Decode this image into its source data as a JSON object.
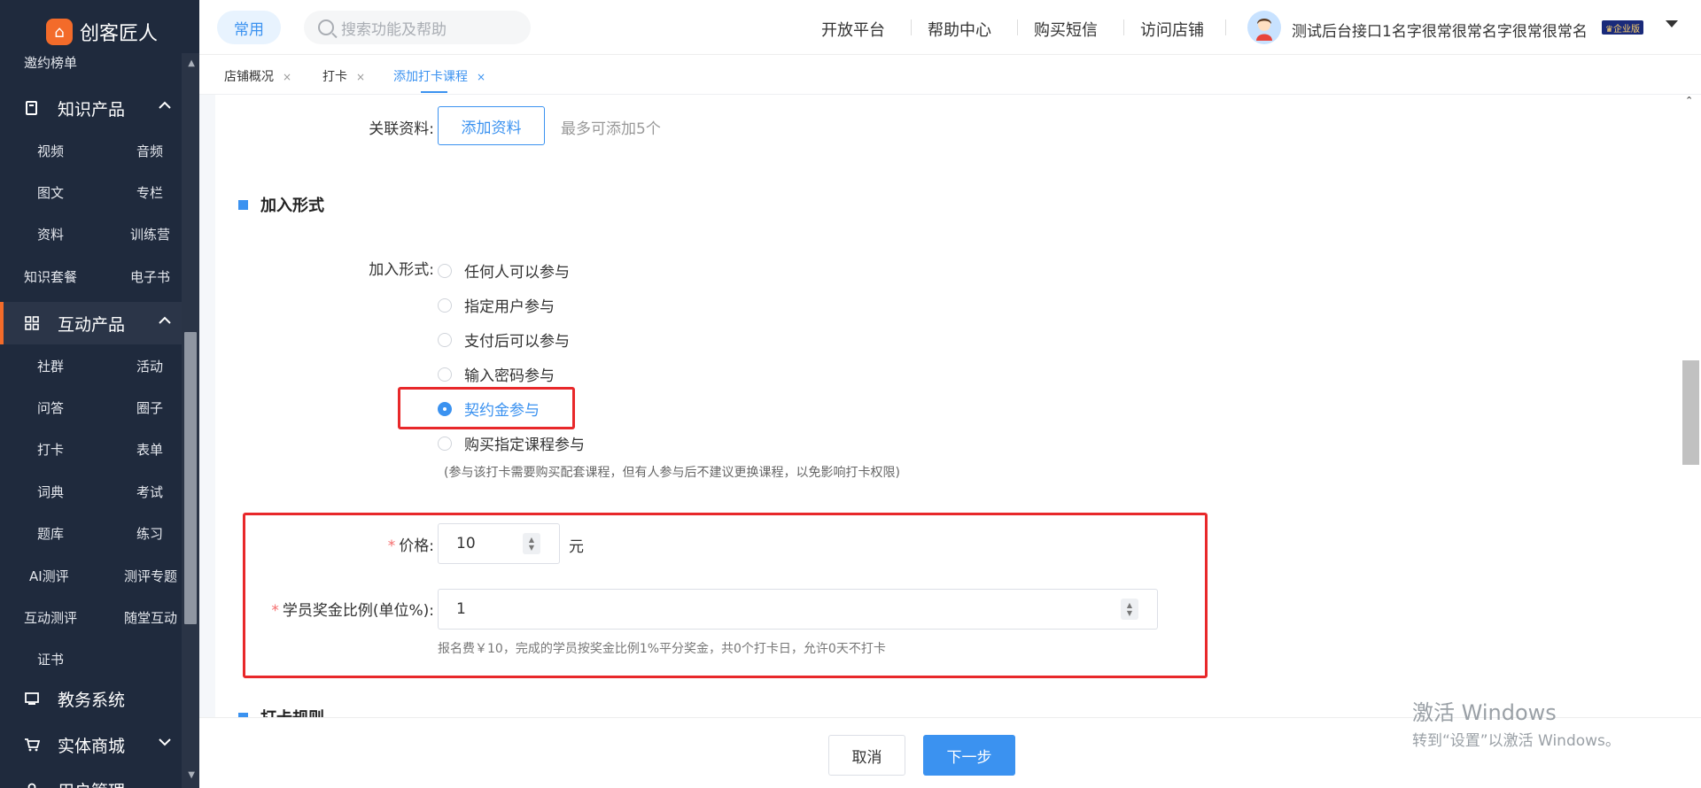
{
  "app": {
    "logo_mark": "⌂",
    "name": "创客匠人"
  },
  "sidebar": {
    "top_item": "邀约榜单",
    "groups": [
      {
        "label": "知识产品",
        "icon": "book-icon",
        "expanded": true
      },
      {
        "label": "互动产品",
        "icon": "grid-icon",
        "expanded": true,
        "active": true
      },
      {
        "label": "教务系统",
        "icon": "classroom-icon"
      },
      {
        "label": "实体商城",
        "icon": "cart-icon",
        "expanded": false
      },
      {
        "label": "用户管理",
        "icon": "user-icon"
      }
    ],
    "knowledge_items": [
      "视频",
      "音频",
      "图文",
      "专栏",
      "资料",
      "训练营",
      "知识套餐",
      "电子书"
    ],
    "interactive_items": [
      "社群",
      "活动",
      "问答",
      "圈子",
      "打卡",
      "表单",
      "词典",
      "考试",
      "题库",
      "练习",
      "AI测评",
      "测评专题",
      "互动测评",
      "随堂互动",
      "证书"
    ]
  },
  "topbar": {
    "pill": "常用",
    "search_placeholder": "搜索功能及帮助",
    "links": [
      "开放平台",
      "帮助中心",
      "购买短信",
      "访问店铺"
    ],
    "user_name": "测试后台接口1名字很常很常名字很常很常名",
    "badge": "♛企业版"
  },
  "tabs": [
    {
      "label": "店铺概况",
      "active": false
    },
    {
      "label": "打卡",
      "active": false
    },
    {
      "label": "添加打卡课程",
      "active": true
    }
  ],
  "form": {
    "related_label": "关联资料:",
    "add_material_button": "添加资料",
    "related_hint": "最多可添加5个",
    "join_section_title": "加入形式",
    "join_label": "加入形式:",
    "join_options": [
      {
        "label": "任何人可以参与",
        "selected": false
      },
      {
        "label": "指定用户参与",
        "selected": false
      },
      {
        "label": "支付后可以参与",
        "selected": false
      },
      {
        "label": "输入密码参与",
        "selected": false
      },
      {
        "label": "契约金参与",
        "selected": true
      },
      {
        "label": "购买指定课程参与",
        "selected": false
      }
    ],
    "course_hint": "(参与该打卡需要购买配套课程，但有人参与后不建议更换课程，以免影响打卡权限)",
    "price_label": "价格:",
    "price_value": "10",
    "price_unit": "元",
    "ratio_label": "学员奖金比例(单位%):",
    "ratio_value": "1",
    "calc_hint": "报名费￥10，完成的学员按奖金比例1%平分奖金，共0个打卡日，允许0天不打卡",
    "rules_section_title": "打卡规则"
  },
  "footer": {
    "cancel": "取消",
    "next": "下一步"
  },
  "watermark": {
    "line1": "激活 Windows",
    "line2": "转到“设置”以激活 Windows。"
  },
  "colors": {
    "accent": "#3b92f0",
    "sidebar_bg": "#1f2a3d",
    "brand_orange": "#f36b2a",
    "highlight_red": "#e8282a"
  }
}
